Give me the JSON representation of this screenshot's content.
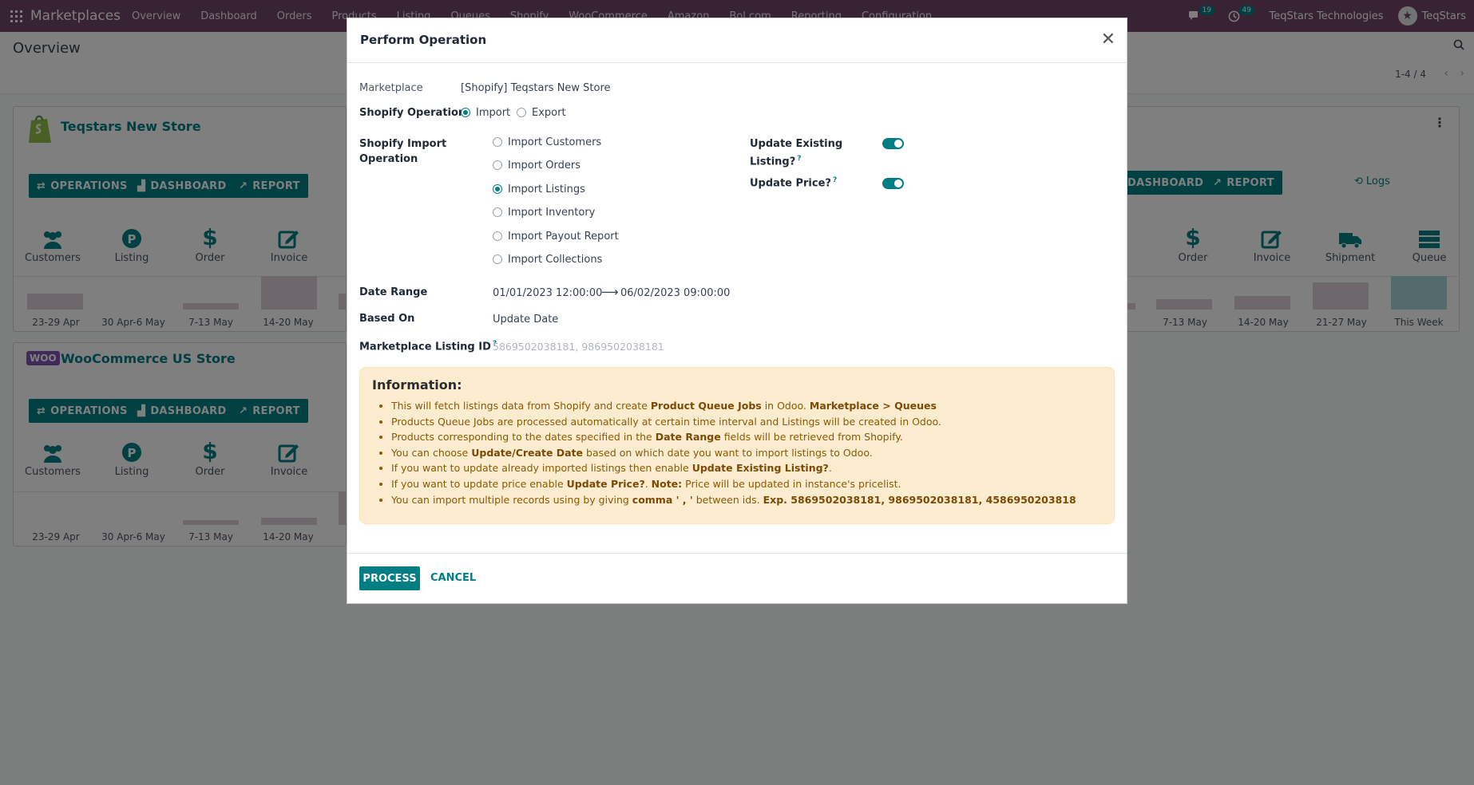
{
  "navbar": {
    "brand": "Marketplaces",
    "menu": [
      "Overview",
      "Dashboard",
      "Orders",
      "Products",
      "Listing",
      "Queues",
      "Shopify",
      "WooCommerce",
      "Amazon",
      "Bol.com",
      "Reporting",
      "Configuration"
    ],
    "messages_count": "19",
    "activities_count": "49",
    "company": "TeqStars Technologies",
    "user": "TeqStars"
  },
  "page": {
    "title": "Overview",
    "pager": "1-4 / 4"
  },
  "stores": [
    {
      "name": "Teqstars New Store",
      "buttons": {
        "operations": "OPERATIONS",
        "dashboard": "DASHBOARD",
        "report": "REPORT"
      },
      "stats": [
        "Customers",
        "Listing",
        "Order",
        "Invoice"
      ],
      "chart_labels": [
        "23-29 Apr",
        "30 Apr-6 May",
        "7-13 May",
        "14-20 May"
      ],
      "right_buttons": {
        "dashboard": "DASHBOARD",
        "report": "REPORT",
        "logs": "Logs"
      },
      "right_stats": [
        "Order",
        "Invoice",
        "Shipment",
        "Queue"
      ],
      "right_chart_labels": [
        "ay",
        "7-13 May",
        "14-20 May",
        "21-27 May",
        "This Week"
      ]
    },
    {
      "name": "WooCommerce US Store",
      "buttons": {
        "operations": "OPERATIONS",
        "dashboard": "DASHBOARD",
        "report": "REPORT"
      },
      "stats": [
        "Customers",
        "Listing",
        "Order",
        "Invoice"
      ],
      "chart_labels": [
        "23-29 Apr",
        "30 Apr-6 May",
        "7-13 May",
        "14-20 May"
      ]
    }
  ],
  "modal": {
    "title": "Perform Operation",
    "marketplace_label": "Marketplace",
    "marketplace_value": "[Shopify] Teqstars New Store",
    "operation_label": "Shopify Operation",
    "operation_options": [
      {
        "label": "Import",
        "selected": true
      },
      {
        "label": "Export",
        "selected": false
      }
    ],
    "import_op_label_1": "Shopify Import",
    "import_op_label_2": "Operation",
    "import_options": [
      {
        "label": "Import Customers",
        "selected": false
      },
      {
        "label": "Import Orders",
        "selected": false
      },
      {
        "label": "Import Listings",
        "selected": true
      },
      {
        "label": "Import Inventory",
        "selected": false
      },
      {
        "label": "Import Payout Report",
        "selected": false
      },
      {
        "label": "Import Collections",
        "selected": false
      }
    ],
    "update_existing_label_1": "Update Existing",
    "update_existing_label_2": "Listing?",
    "update_existing_on": true,
    "update_price_label": "Update Price?",
    "update_price_on": true,
    "help_mark": "?",
    "date_range_label": "Date Range",
    "date_from": "01/01/2023 12:00:00",
    "date_to": "06/02/2023 09:00:00",
    "based_on_label": "Based On",
    "based_on_value": "Update Date",
    "listing_id_label": "Marketplace Listing ID",
    "listing_id_placeholder": "5869502038181, 9869502038181",
    "info_title": "Information:",
    "info_items": [
      [
        "This will fetch listings data from Shopify and create ",
        {
          "b": "Product Queue Jobs"
        },
        " in Odoo. ",
        {
          "b": "Marketplace > Queues"
        }
      ],
      [
        "Products Queue Jobs are processed automatically at certain time interval and Listings will be created in Odoo."
      ],
      [
        "Products corresponding to the dates specified in the ",
        {
          "b": "Date Range"
        },
        " fields will be retrieved from Shopify."
      ],
      [
        "You can choose ",
        {
          "b": "Update/Create Date"
        },
        " based on which date you want to import listings to Odoo."
      ],
      [
        "If you want to update already imported listings then enable ",
        {
          "b": "Update Existing Listing?"
        },
        "."
      ],
      [
        "If you want to update price enable ",
        {
          "b": "Update Price?"
        },
        ". ",
        {
          "b": "Note:"
        },
        " Price will be updated in instance's pricelist."
      ],
      [
        "You can import multiple records using by giving ",
        {
          "b": "comma ' , '"
        },
        " between ids. ",
        {
          "b": "Exp. 5869502038181, 9869502038181, 4586950203818"
        }
      ]
    ],
    "process_label": "PROCESS",
    "cancel_label": "CANCEL"
  }
}
